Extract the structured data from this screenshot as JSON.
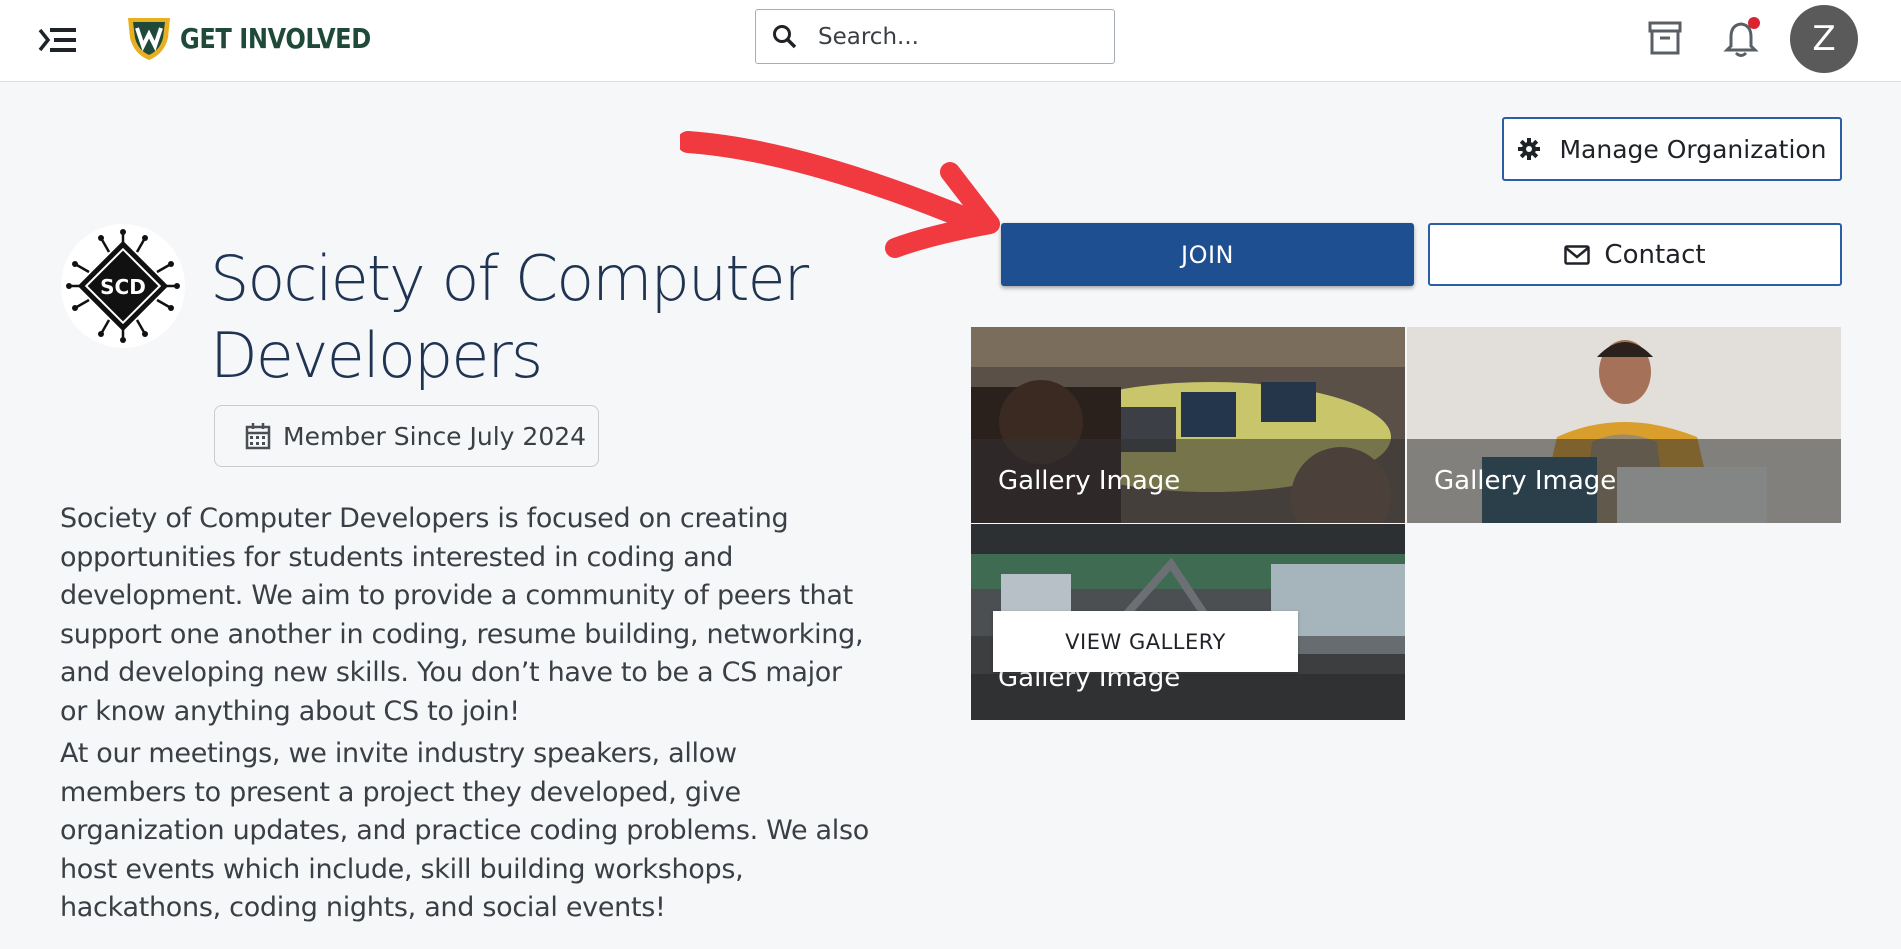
{
  "nav": {
    "logo_text": "GET INVOLVED",
    "search_placeholder": "Search...",
    "avatar_initial": "Z",
    "icons": [
      "menu-collapse-icon",
      "search-icon",
      "archive-icon",
      "bell-icon"
    ]
  },
  "actions": {
    "manage_label": "Manage Organization",
    "join_label": "JOIN",
    "contact_label": "Contact"
  },
  "org": {
    "logo_text": "SCD",
    "name": "Society of Computer Developers",
    "member_since": "Member Since July 2024",
    "description": [
      "Society of Computer Developers is focused on creating opportunities for students interested in coding and development. We aim to provide a community of peers that support one another in coding, resume building, networking, and developing new skills. You don’t have to be a CS major or know anything about CS to join!",
      "At our meetings, we invite industry speakers, allow members to present a project they developed, give organization updates, and practice coding problems. We also host events which include, skill building workshops, hackathons, coding nights, and social events!"
    ]
  },
  "gallery": {
    "items": [
      {
        "caption": "Gallery Image"
      },
      {
        "caption": "Gallery Image"
      },
      {
        "caption": "Gallery Image"
      }
    ],
    "view_label": "VIEW GALLERY"
  },
  "colors": {
    "primary": "#1d4f91",
    "outline": "#2b5ea6",
    "title": "#1f3352",
    "annotation": "#f03a3f"
  }
}
